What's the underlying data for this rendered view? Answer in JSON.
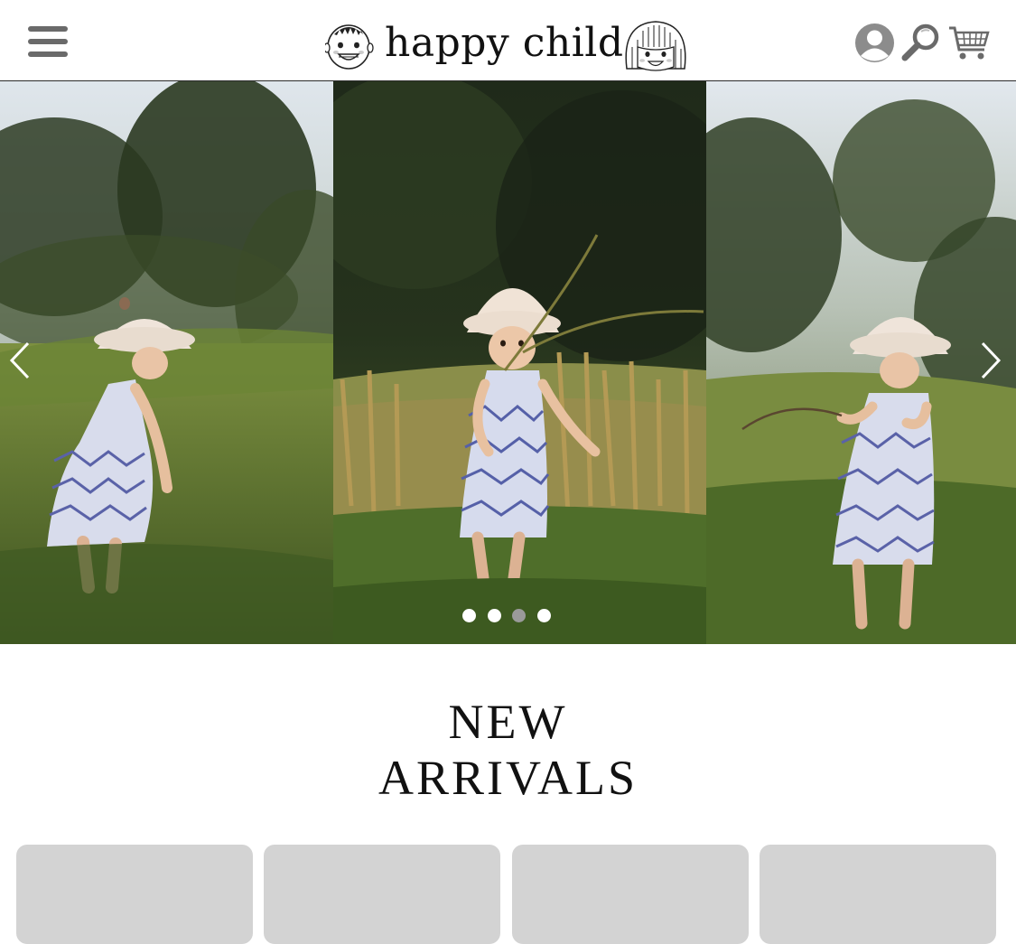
{
  "header": {
    "brand_name": "happy child",
    "menu_icon": "hamburger-menu-icon",
    "account_icon": "user-icon",
    "search_icon": "search-icon",
    "cart_icon": "cart-icon"
  },
  "hero": {
    "prev_icon": "chevron-left-icon",
    "next_icon": "chevron-right-icon",
    "slide_count": 4,
    "active_slide": 3
  },
  "new_arrivals": {
    "title_line1": "NEW",
    "title_line2": "ARRIVALS"
  },
  "colors": {
    "header_border": "#2b2b2b",
    "icon_gray": "#6a6a6a",
    "card_placeholder": "#d3d3d3",
    "dot_active": "#9a9a9a"
  }
}
